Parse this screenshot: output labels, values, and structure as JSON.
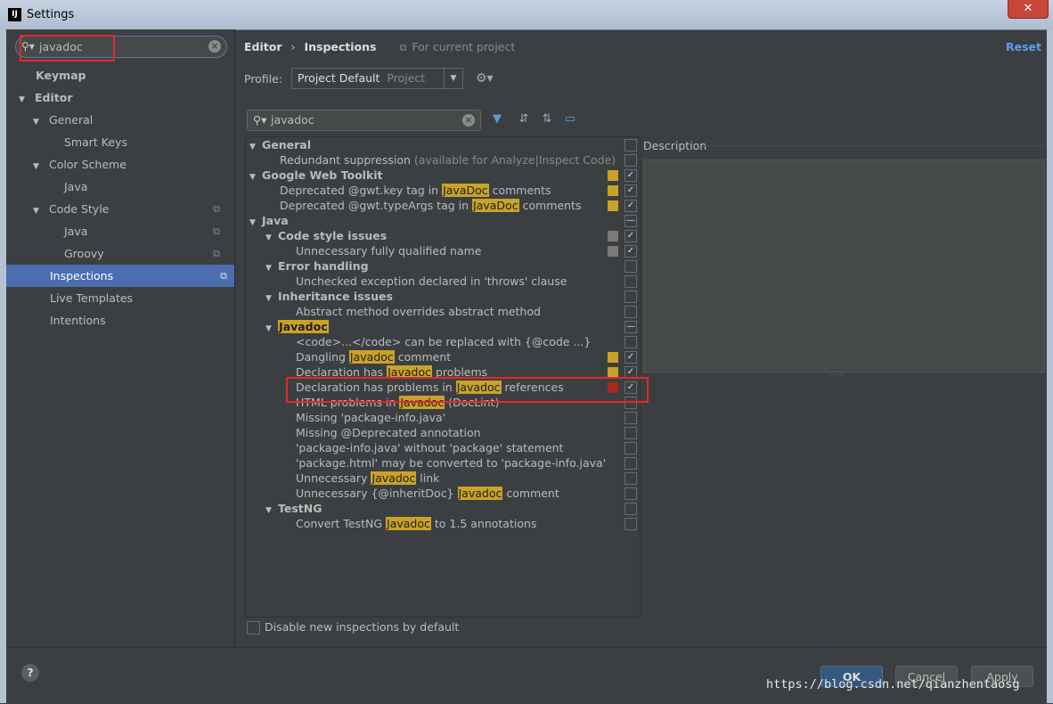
{
  "window": {
    "title": "Settings",
    "app_icon": "IJ",
    "close_symbol": "✕"
  },
  "sidebar": {
    "search_value": "javadoc",
    "items": [
      {
        "label": "Keymap"
      },
      {
        "label": "Editor"
      },
      {
        "label": "General"
      },
      {
        "label": "Smart Keys"
      },
      {
        "label": "Color Scheme"
      },
      {
        "label": "Java"
      },
      {
        "label": "Code Style"
      },
      {
        "label": "Java"
      },
      {
        "label": "Groovy"
      },
      {
        "label": "Inspections"
      },
      {
        "label": "Live Templates"
      },
      {
        "label": "Intentions"
      }
    ],
    "selected": "Inspections"
  },
  "header": {
    "breadcrumb_root": "Editor",
    "breadcrumb_sep": "›",
    "breadcrumb_current": "Inspections",
    "scope_note": "For current project",
    "reset": "Reset"
  },
  "profile": {
    "label": "Profile:",
    "value": "Project Default",
    "scope": "Project"
  },
  "inspection_search": {
    "value": "javadoc"
  },
  "inspections": {
    "rows": [
      {
        "text": "General"
      },
      {
        "text": "Redundant suppression ",
        "note": "(available for Analyze|Inspect Code)"
      },
      {
        "text": "Google Web Toolkit"
      },
      {
        "pre": "Deprecated @gwt.key tag in ",
        "hl": "JavaDoc",
        "post": " comments"
      },
      {
        "pre": "Deprecated @gwt.typeArgs tag in ",
        "hl": "JavaDoc",
        "post": " comments"
      },
      {
        "text": "Java"
      },
      {
        "text": "Code style issues"
      },
      {
        "text": "Unnecessary fully qualified name"
      },
      {
        "text": "Error handling"
      },
      {
        "text": "Unchecked exception declared in 'throws' clause"
      },
      {
        "text": "Inheritance issues"
      },
      {
        "text": "Abstract method overrides abstract method"
      },
      {
        "hl": "Javadoc"
      },
      {
        "text": "<code>...</code> can be replaced with {@code ...}"
      },
      {
        "pre": "Dangling ",
        "hl": "Javadoc",
        "post": " comment"
      },
      {
        "pre": "Declaration has ",
        "hl": "Javadoc",
        "post": " problems"
      },
      {
        "pre": "Declaration has problems in ",
        "hl": "Javadoc",
        "post": " references"
      },
      {
        "pre": "HTML problems in ",
        "hl": "Javadoc",
        "post": " (DocLint)"
      },
      {
        "text": "Missing 'package-info.java'"
      },
      {
        "text": "Missing @Deprecated annotation"
      },
      {
        "text": "'package-info.java' without 'package' statement"
      },
      {
        "text": "'package.html' may be converted to 'package-info.java'"
      },
      {
        "pre": "Unnecessary ",
        "hl": "Javadoc",
        "post": " link"
      },
      {
        "pre": "Unnecessary {@inheritDoc} ",
        "hl": "Javadoc",
        "post": " comment"
      },
      {
        "text": "TestNG"
      },
      {
        "pre": "Convert TestNG ",
        "hl": "Javadoc",
        "post": " to 1.5 annotations"
      }
    ]
  },
  "description": {
    "label": "Description"
  },
  "disable_new": {
    "label": "Disable new inspections by default"
  },
  "footer": {
    "help": "?",
    "ok": "OK",
    "cancel": "Cancel",
    "apply": "Apply"
  },
  "watermark": "https://blog.csdn.net/qianzhentaosg",
  "colors": {
    "accent": "#4b6eaf",
    "highlight": "#c9a227",
    "severity_warning": "#c9a227",
    "severity_error": "#c0392b",
    "severity_weak": "#7a7a7a",
    "annotation_box": "#e0292c"
  }
}
